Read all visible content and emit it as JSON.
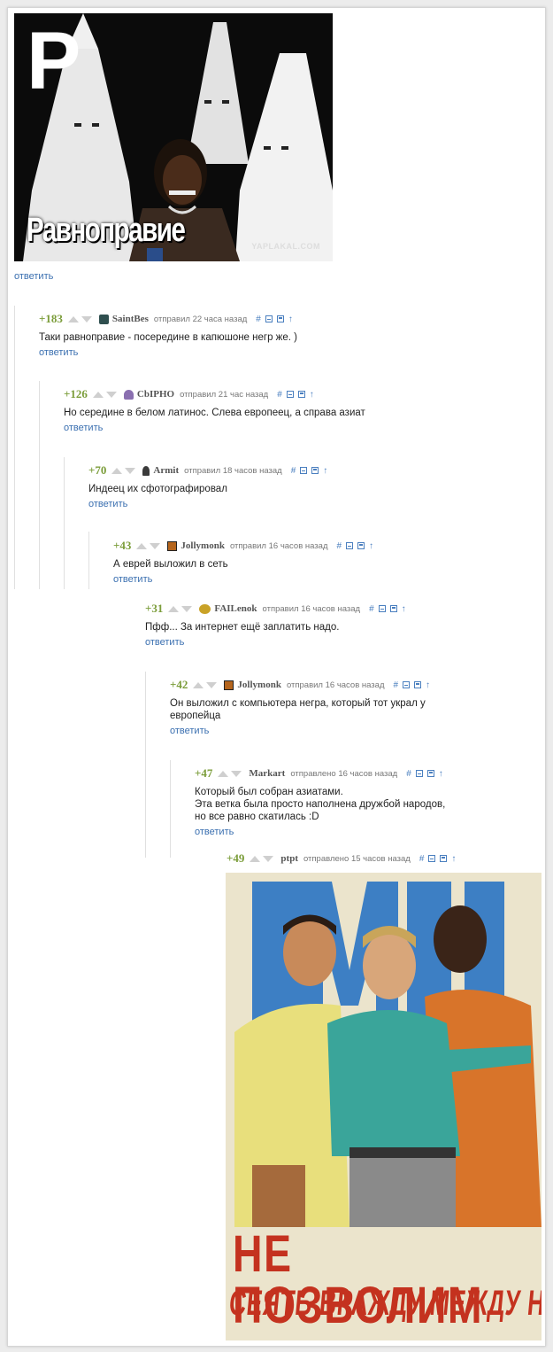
{
  "post": {
    "image_letter": "Р",
    "image_caption": "Равноправие",
    "image_watermark": "YAPLAKAL.COM",
    "reply_label": "ответить"
  },
  "comments": [
    {
      "rating": "+183",
      "author": "SaintBes",
      "sent": "отправил 22 часа назад",
      "text": "Таки равноправие - посередине в капюшоне негр же. )",
      "reply": "ответить",
      "avatar_color": "#2f4f4f"
    },
    {
      "rating": "+126",
      "author": "CbIPHO",
      "sent": "отправил 21 час назад",
      "text": "Но середине в белом латинос. Слева европеец, а справа азиат",
      "reply": "ответить",
      "avatar_color": "#8a6fb0"
    },
    {
      "rating": "+70",
      "author": "Armit",
      "sent": "отправил 18 часов назад",
      "text": "Индеец их сфотографировал",
      "reply": "ответить",
      "avatar_color": "#3b3b3b"
    },
    {
      "rating": "+43",
      "author": "Jollymonk",
      "sent": "отправил 16 часов назад",
      "text": "А еврей выложил в сеть",
      "reply": "ответить",
      "avatar_color": "#b5651d"
    },
    {
      "rating": "+31",
      "author": "FAILenok",
      "sent": "отправил 16 часов назад",
      "text": "Пфф... За интернет ещё заплатить надо.",
      "reply": "ответить",
      "avatar_color": "#c9a227"
    },
    {
      "rating": "+42",
      "author": "Jollymonk",
      "sent": "отправил 16 часов назад",
      "text": "Он выложил с компьютера негра, который тот украл у\nевропейца",
      "reply": "ответить",
      "avatar_color": "#b5651d"
    },
    {
      "rating": "+47",
      "author": "Markart",
      "sent": "отправлено 16 часов назад",
      "text": "Который был собран азиатами.\nЭта ветка была просто наполнена дружбой народов,\nно все равно скатилась :D",
      "reply": "ответить",
      "avatar_color": ""
    },
    {
      "rating": "+49",
      "author": "ptpt",
      "sent": "отправлено 15 часов назад",
      "text": "",
      "reply": "",
      "avatar_color": ""
    }
  ],
  "poster": {
    "line1": "НЕ ПОЗВОЛИМ",
    "line2": "СЕЯТЬ ВРАЖДУ МЕЖДУ НАРОДАМИ!"
  },
  "tools": {
    "hash": "#",
    "up": "↑"
  },
  "colors": {
    "link": "#3a6fb0",
    "rating": "#7b9d3a",
    "poster_red": "#c4321f"
  }
}
